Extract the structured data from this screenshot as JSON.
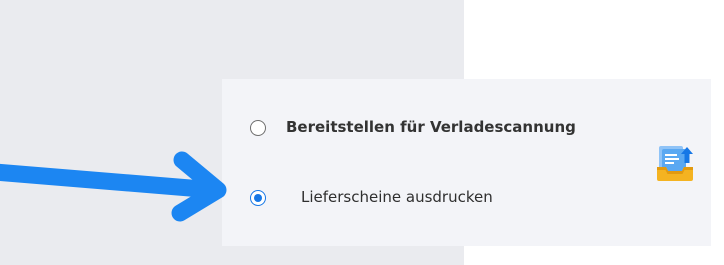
{
  "options": [
    {
      "label": "Bereitstellen für Verladescannung",
      "selected": false
    },
    {
      "label": "Lieferscheine ausdrucken",
      "selected": true
    }
  ],
  "colors": {
    "accent": "#1677e6",
    "arrow": "#1c86f2"
  },
  "icons": {
    "tray": "tray-upload-icon",
    "arrow": "pointer-arrow-icon"
  }
}
